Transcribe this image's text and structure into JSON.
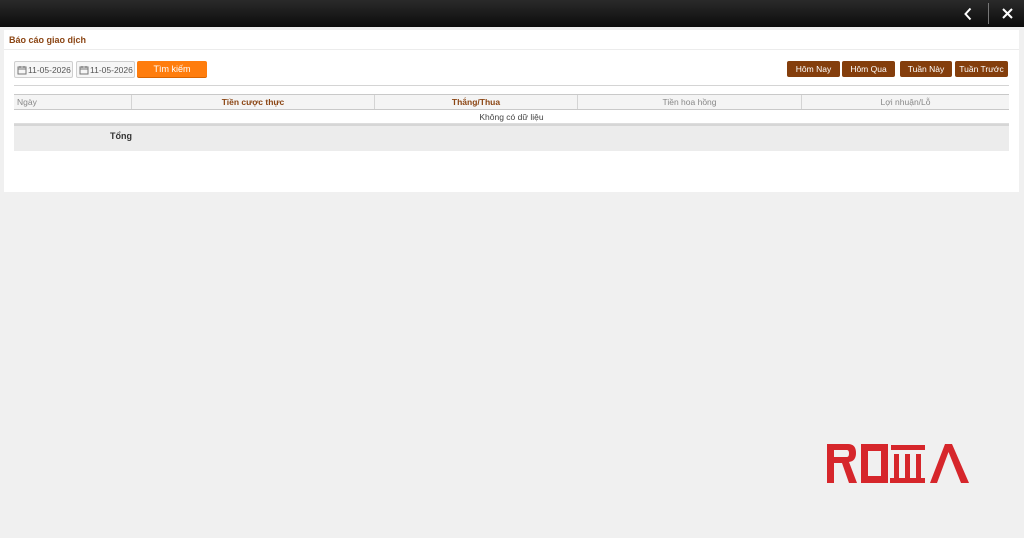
{
  "topbar": {
    "back_icon": "chevron-left-icon",
    "close_icon": "close-icon"
  },
  "panel": {
    "title": "Báo cáo giao dịch",
    "date_from": "11-05-2026",
    "date_to": "11-05-2026",
    "search_label": "Tìm kiếm",
    "quick_buttons": [
      "Hôm Nay",
      "Hôm Qua",
      "Tuần Này",
      "Tuần Trước"
    ]
  },
  "table": {
    "columns": [
      "Ngày",
      "Tiền cược thực",
      "Thắng/Thua",
      "Tiền hoa hồng",
      "Lợi nhuận/Lỗ"
    ],
    "empty_text": "Không có dữ liệu",
    "total_label": "Tổng"
  },
  "logo": {
    "text": "ROMA"
  },
  "colors": {
    "brand_brown": "#843e0c",
    "accent_orange": "#ff7d0d",
    "logo_red": "#d6262b"
  }
}
